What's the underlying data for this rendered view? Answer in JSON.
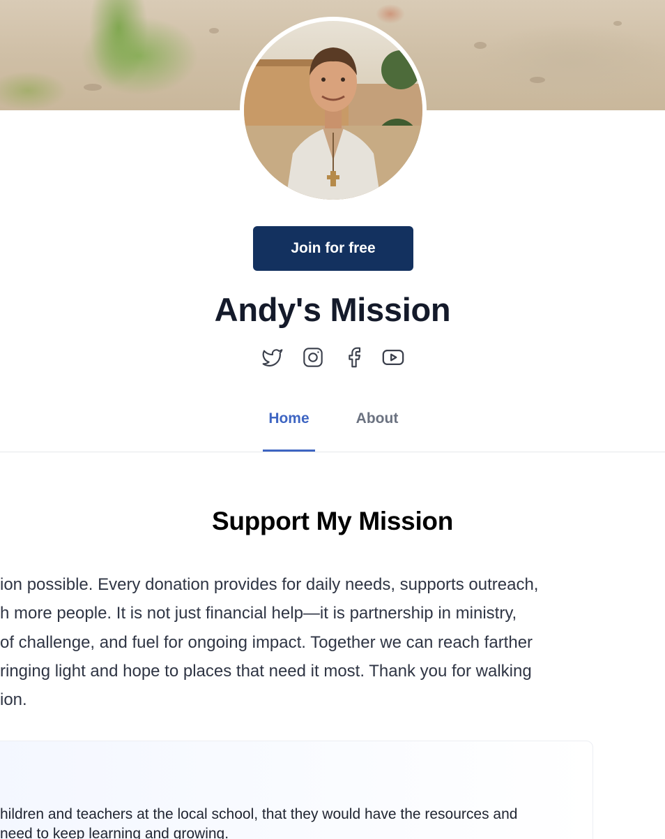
{
  "profile": {
    "join_label": "Join for free",
    "name": "Andy's Mission"
  },
  "socials": [
    {
      "icon": "twitter-icon"
    },
    {
      "icon": "instagram-icon"
    },
    {
      "icon": "facebook-icon"
    },
    {
      "icon": "youtube-icon"
    }
  ],
  "tabs": [
    {
      "label": "Home",
      "active": true
    },
    {
      "label": "About",
      "active": false
    }
  ],
  "colors": {
    "primary_button": "#13315f",
    "active_tab": "#3e65c2",
    "inactive_tab": "#6b7280"
  },
  "mission": {
    "title": "Support My Mission",
    "lines": [
      "ion possible. Every donation provides for daily needs, supports outreach,",
      "h more people. It is not just financial help—it is partnership in ministry,",
      "of challenge, and fuel for ongoing impact. Together we can reach farther",
      "ringing light and hope to places that need it most. Thank you for walking",
      "ion."
    ]
  },
  "prayer_card": {
    "lines": [
      "hildren and teachers at the local school, that they would have the resources and",
      "need to keep learning and growing."
    ]
  }
}
